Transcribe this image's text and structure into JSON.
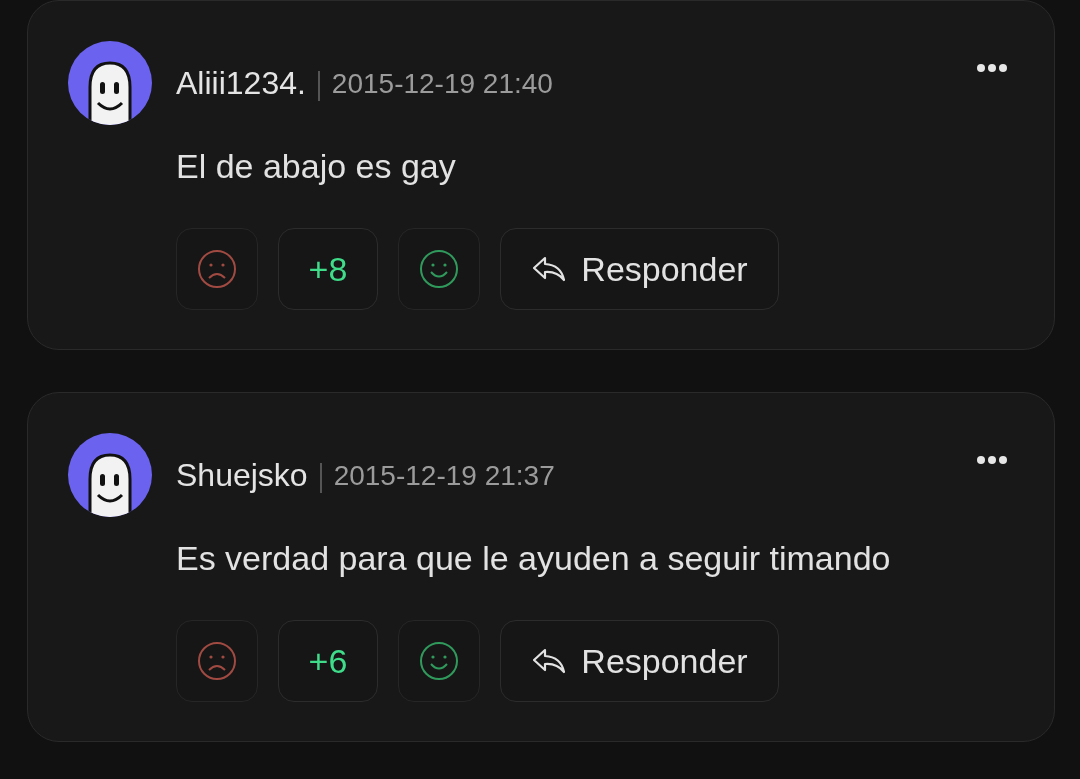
{
  "comments": [
    {
      "author": "Aliii1234.",
      "time": "2015-12-19 21:40",
      "body": "El de abajo es gay",
      "score": "+8",
      "reply_label": "Responder"
    },
    {
      "author": "Shuejsko",
      "time": "2015-12-19 21:37",
      "body": "Es verdad para que le ayuden a seguir timando",
      "score": "+6",
      "reply_label": "Responder"
    }
  ]
}
